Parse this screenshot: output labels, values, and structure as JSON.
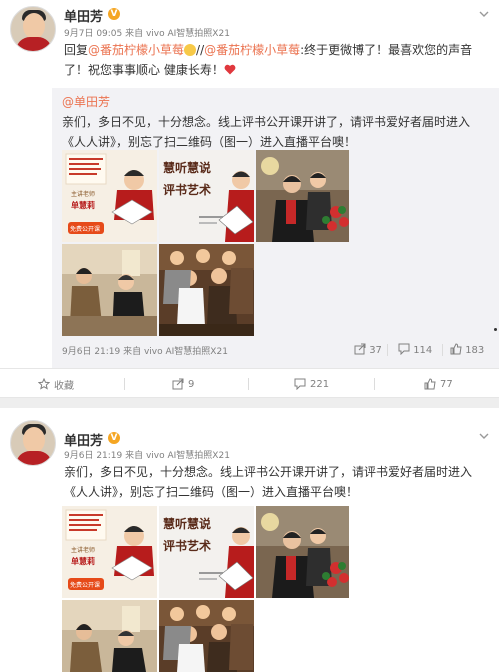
{
  "post1": {
    "user_name": "单田芳",
    "verified_badge": "V",
    "meta": "9月7日 09:05 来自 vivo AI智慧拍照X21",
    "text_prefix": "回复",
    "mention1": "@番茄柠檬小草莓",
    "text_mid": "//",
    "mention2": "@番茄柠檬小草莓",
    "text_rest": ":终于更微博了！最喜欢您的声音了！祝您事事顺心 健康长寿！",
    "emoji": "smile-emoji-icon",
    "heart": "heart-icon",
    "repost": {
      "user": "@单田芳",
      "text": "亲们，多日不见，十分想念。线上评书公开课开讲了，请评书爱好者届时进入《人人讲》，别忘了扫二维码（图一）进入直播平台噢！",
      "meta": "9月6日 21:19 来自 vivo AI智慧拍照X21",
      "share_count": "37",
      "comment_count": "114",
      "like_count": "183"
    },
    "actions": {
      "favorite_label": "收藏",
      "share_count": "9",
      "comment_count": "221",
      "like_count": "77"
    }
  },
  "post2": {
    "user_name": "单田芳",
    "verified_badge": "V",
    "meta": "9月6日 21:19 来自 vivo AI智慧拍照X21",
    "text_line1": "亲们，多日不见，十分想念。线上评书公开课开讲了，请评书爱好者届时进入",
    "text_line2": "《人人讲》，别忘了扫二维码（图一）进入直播平台噢！"
  },
  "images": {
    "poster1_teacher_label": "主讲老师",
    "poster1_teacher_name": "单慧莉",
    "poster1_badge": "免费公开课",
    "poster2_title1": "慧听慧说",
    "poster2_title2": "评书艺术"
  },
  "colors": {
    "link": "#eb7350",
    "badge": "#f5a623",
    "heart": "#e0383e",
    "repost_bg": "#f2f2f5"
  }
}
